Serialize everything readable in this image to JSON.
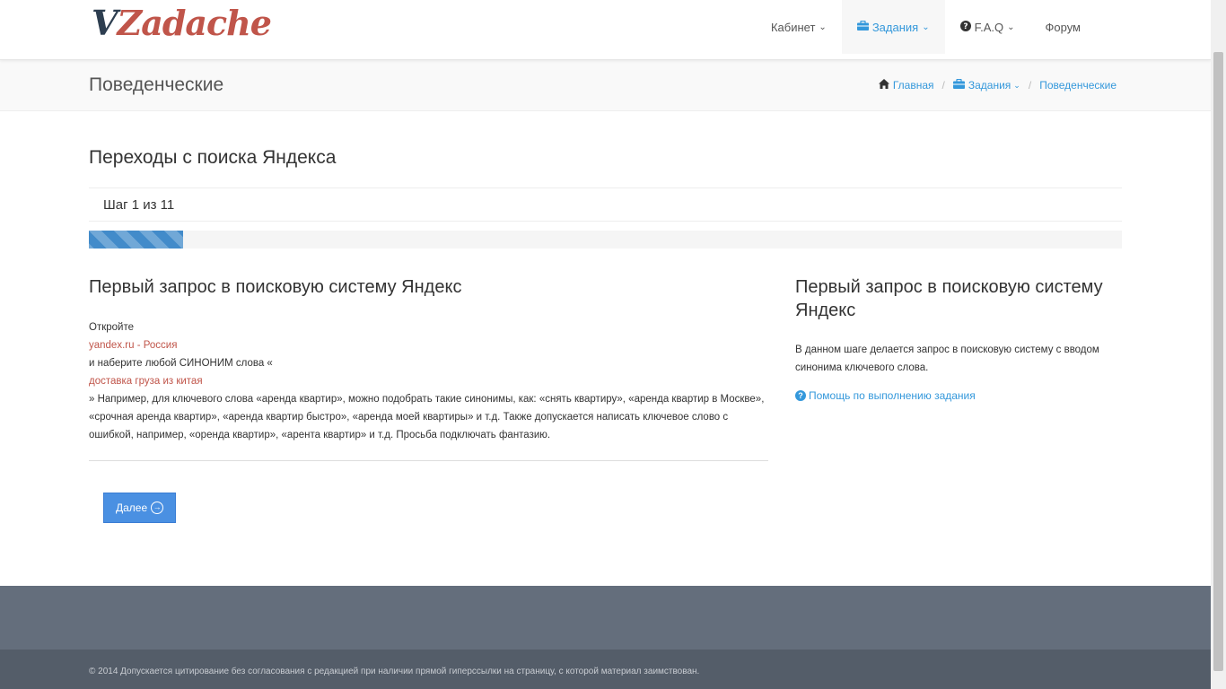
{
  "header": {
    "logo_v": "V",
    "logo_rest": "Zadache",
    "nav": [
      {
        "label": "Кабинет"
      },
      {
        "label": "Задания"
      },
      {
        "label": "F.A.Q"
      },
      {
        "label": "Форум"
      }
    ]
  },
  "title_bar": {
    "title": "Поведенческие",
    "breadcrumb": [
      "Главная",
      "Задания",
      "Поведенческие"
    ]
  },
  "task": {
    "title": "Переходы с поиска Яндекса",
    "step": "Шаг 1 из 11",
    "progress_fraction": 0.0909
  },
  "main": {
    "heading": "Первый запрос в поисковую систему Яндекс",
    "line1": "Откройте",
    "link1": "yandex.ru - Россия",
    "line2": "и наберите любой СИНОНИМ слова «",
    "keyword": "доставка груза из китая",
    "line3": "» Например, для ключевого слова «аренда квартир», можно подобрать такие синонимы, как: «снять квартиру», «аренда квартир в Москве», «срочная аренда квартир», «аренда квартир быстро», «аренда моей квартиры» и т.д. Также допускается написать ключевое слово с ошибкой, например, «оренда квартир», «арента квартир» и т.д. Просьба подключать фантазию.",
    "next_label": "Далее"
  },
  "side": {
    "heading": "Первый запрос в поисковую систему Яндекс",
    "text": "В данном шаге делается запрос в поисковую систему с вводом синонима ключевого слова.",
    "help_label": "Помощь по выполнению задания"
  },
  "footer": {
    "copyright": "© 2014 Допускается цитирование без согласования с редакцией при наличии прямой гиперссылки на страницу, с которой материал заимствован."
  }
}
